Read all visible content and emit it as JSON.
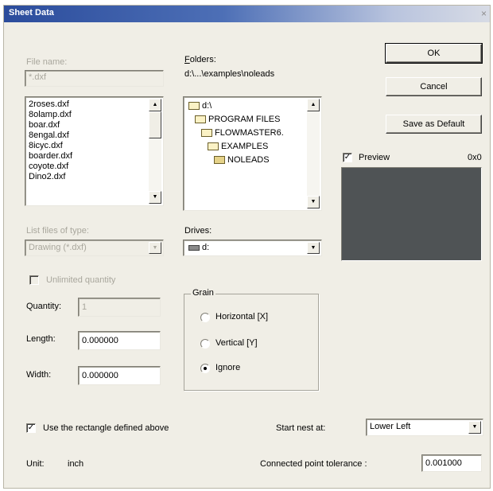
{
  "window": {
    "title": "Sheet Data",
    "close_glyph": "×"
  },
  "file": {
    "name_label": "File name:",
    "name_value": "*.dxf",
    "files": [
      "2roses.dxf",
      "8olamp.dxf",
      "boar.dxf",
      "8engal.dxf",
      "8icyc.dxf",
      "boarder.dxf",
      "coyote.dxf",
      "Dino2.dxf"
    ],
    "type_label": "List files of type:",
    "type_value": "Drawing (*.dxf)"
  },
  "folders": {
    "label": "Folders:",
    "path": "d:\\...\\examples\\noleads",
    "items": [
      {
        "name": "d:\\",
        "icon": "open-folder-icon"
      },
      {
        "name": "PROGRAM FILES",
        "icon": "open-folder-icon"
      },
      {
        "name": "FLOWMASTER6.",
        "icon": "open-folder-icon"
      },
      {
        "name": "EXAMPLES",
        "icon": "open-folder-icon"
      },
      {
        "name": "NOLEADS",
        "icon": "closed-folder-icon"
      }
    ],
    "drives_label": "Drives:",
    "drive_value": "d:"
  },
  "buttons": {
    "ok": "OK",
    "cancel": "Cancel",
    "save_default": "Save as Default"
  },
  "preview": {
    "label": "Preview",
    "checked": true,
    "size": "0x0",
    "color": "#4f5355"
  },
  "quantity": {
    "unlimited_label": "Unlimited quantity",
    "quantity_label": "Quantity:",
    "quantity_value": "1",
    "length_label": "Length:",
    "length_value": "0.000000",
    "width_label": "Width:",
    "width_value": "0.000000"
  },
  "grain": {
    "title": "Grain",
    "options": [
      "Horizontal [X]",
      "Vertical [Y]",
      "Ignore"
    ],
    "selected": "Ignore"
  },
  "footer": {
    "use_rect_label": "Use the rectangle defined above",
    "use_rect_checked": true,
    "start_nest_label": "Start nest at:",
    "start_nest_value": "Lower Left",
    "unit_label": "Unit:",
    "unit_value": "inch",
    "tolerance_label": "Connected point tolerance :",
    "tolerance_value": "0.001000"
  }
}
